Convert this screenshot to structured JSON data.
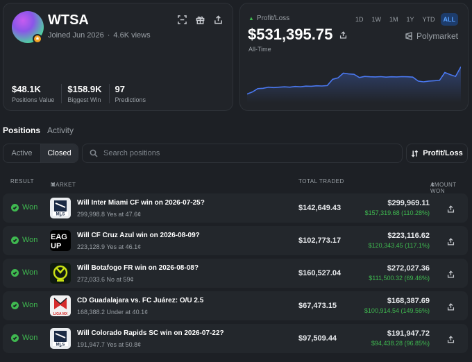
{
  "profile": {
    "username": "WTSA",
    "joined": "Joined Jun 2026",
    "views": "4.6K views",
    "stats": [
      {
        "value": "$48.1K",
        "label": "Positions Value"
      },
      {
        "value": "$158.9K",
        "label": "Biggest Win"
      },
      {
        "value": "97",
        "label": "Predictions"
      }
    ]
  },
  "pnl": {
    "label": "Profit/Loss",
    "value": "$531,395.75",
    "period": "All-Time",
    "ranges": [
      "1D",
      "1W",
      "1M",
      "1Y",
      "YTD",
      "ALL"
    ],
    "active_range": "ALL",
    "brand": "Polymarket",
    "line_color": "#4a78f0"
  },
  "tabs": {
    "positions": "Positions",
    "activity": "Activity"
  },
  "filters": {
    "active": "Active",
    "closed": "Closed",
    "search_placeholder": "Search positions",
    "sort": "Profit/Loss"
  },
  "table": {
    "headers": {
      "result": "RESULT",
      "market": "MARKET",
      "traded": "TOTAL TRADED",
      "won": "AMOUNT WON"
    },
    "rows": [
      {
        "result": "Won",
        "logo": "mls-logo",
        "title": "Will Inter Miami CF win on 2026-07-25?",
        "sub": "299,998.8 Yes at 47.6¢",
        "traded": "$142,649.43",
        "amount": "$299,969.11",
        "gain": "$157,319.68 (110.28%)"
      },
      {
        "result": "Won",
        "logo": "league-cup-logo",
        "title": "Will CF Cruz Azul win on 2026-08-09?",
        "sub": "223,128.9 Yes at 46.1¢",
        "traded": "$102,773.17",
        "amount": "$223,116.62",
        "gain": "$120,343.45 (117.1%)"
      },
      {
        "result": "Won",
        "logo": "brasileirao-logo",
        "title": "Will Botafogo FR win on 2026-08-08?",
        "sub": "272,033.6 No at 59¢",
        "traded": "$160,527.04",
        "amount": "$272,027.36",
        "gain": "$111,500.32 (69.46%)"
      },
      {
        "result": "Won",
        "logo": "liga-mx-logo",
        "title": "CD Guadalajara vs. FC Juárez: O/U 2.5",
        "sub": "168,388.2 Under at 40.1¢",
        "traded": "$67,473.15",
        "amount": "$168,387.69",
        "gain": "$100,914.54 (149.56%)"
      },
      {
        "result": "Won",
        "logo": "mls-logo",
        "title": "Will Colorado Rapids SC win on 2026-07-22?",
        "sub": "191,947.7 Yes at 50.8¢",
        "traded": "$97,509.44",
        "amount": "$191,947.72",
        "gain": "$94,438.28 (96.85%)"
      }
    ]
  },
  "chart_data": {
    "type": "area",
    "title": "",
    "xlabel": "",
    "ylabel": "",
    "x": [
      0,
      1,
      2,
      3,
      4,
      5,
      6,
      7,
      8,
      9,
      10,
      11,
      12,
      13,
      14,
      15,
      16,
      17,
      18,
      19,
      20,
      21,
      22,
      23,
      24,
      25,
      26,
      27,
      28,
      29,
      30,
      31,
      32,
      33,
      34,
      35,
      36,
      37,
      38,
      39,
      40
    ],
    "values": [
      120,
      150,
      195,
      200,
      215,
      210,
      215,
      220,
      215,
      225,
      220,
      230,
      228,
      235,
      232,
      238,
      325,
      345,
      410,
      400,
      395,
      350,
      365,
      360,
      358,
      362,
      355,
      360,
      358,
      362,
      360,
      355,
      300,
      290,
      300,
      305,
      310,
      420,
      390,
      365,
      500
    ],
    "ylim": [
      0,
      560
    ],
    "grid": false,
    "series": [
      {
        "color": "#4a78f0"
      }
    ]
  }
}
